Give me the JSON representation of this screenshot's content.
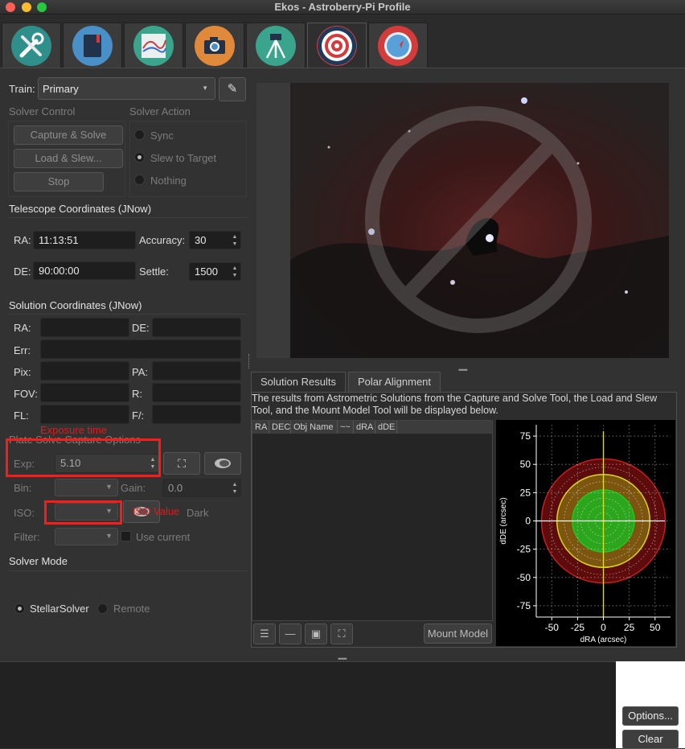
{
  "window": {
    "title": "Ekos - Astroberry-Pi Profile"
  },
  "module_tabs": [
    {
      "icon": "setup-wrench-icon",
      "color": "#2f8f8a"
    },
    {
      "icon": "scheduler-notebook-icon",
      "color": "#4a90c8"
    },
    {
      "icon": "analyze-graph-icon",
      "color": "#3aa58c"
    },
    {
      "icon": "capture-camera-icon",
      "color": "#e0893a"
    },
    {
      "icon": "mount-tripod-icon",
      "color": "#3aa58c"
    },
    {
      "icon": "align-target-icon",
      "color": "#d43c3c"
    },
    {
      "icon": "guide-compass-icon",
      "color": "#d43c3c"
    }
  ],
  "train": {
    "label": "Train:",
    "value": "Primary"
  },
  "solver_control": {
    "title": "Solver Control",
    "capture_solve": "Capture & Solve",
    "load_slew": "Load & Slew...",
    "stop": "Stop"
  },
  "solver_action": {
    "title": "Solver Action",
    "options": [
      "Sync",
      "Slew to Target",
      "Nothing"
    ],
    "selected": 1
  },
  "telescope_coords": {
    "title": "Telescope Coordinates (JNow)",
    "ra_label": "RA:",
    "ra": "11:13:51",
    "de_label": "DE:",
    "de": "90:00:00",
    "accuracy_label": "Accuracy:",
    "accuracy": "30",
    "settle_label": "Settle:",
    "settle": "1500"
  },
  "solution_coords": {
    "title": "Solution Coordinates (JNow)",
    "ra_label": "RA:",
    "de_label": "DE:",
    "err_label": "Err:",
    "pix_label": "Pix:",
    "pa_label": "PA:",
    "fov_label": "FOV:",
    "r_label": "R:",
    "fl_label": "FL:",
    "f_label": "F/:"
  },
  "capture_options": {
    "title": "Plate Solve Capture Options",
    "exp_label": "Exp:",
    "exp": "5.10",
    "bin_label": "Bin:",
    "gain_label": "Gain:",
    "gain": "0.0",
    "iso_label": "ISO:",
    "dark_label": "Dark",
    "filter_label": "Filter:",
    "use_current": "Use current"
  },
  "annotations": {
    "exposure": "Exposure time",
    "iso": "ISO Value"
  },
  "solver_mode": {
    "title": "Solver Mode",
    "options": [
      "StellarSolver",
      "Remote"
    ],
    "selected": 0
  },
  "results_tabs": [
    "Solution Results",
    "Polar Alignment"
  ],
  "results_description": "The results from Astrometric Solutions from the Capture and Solve Tool, the Load and Slew Tool, and the Mount Model Tool will be displayed below.",
  "table_columns": [
    "RA",
    "DEC",
    "Obj Name",
    "~~",
    "dRA",
    "dDE"
  ],
  "mount_model_button": "Mount Model",
  "bottom_buttons": {
    "options": "Options...",
    "clear": "Clear"
  },
  "chart_data": {
    "type": "scatter",
    "xlabel": "dRA (arcsec)",
    "ylabel": "dDE (arcsec)",
    "xlim": [
      -65,
      65
    ],
    "ylim": [
      -85,
      85
    ],
    "x_ticks": [
      -50,
      -25,
      0,
      25,
      50
    ],
    "y_ticks": [
      75,
      50,
      25,
      0,
      -25,
      -50,
      -75
    ],
    "accuracy_rings": [
      {
        "radius": 60,
        "color": "#c81e1e"
      },
      {
        "radius": 45,
        "color": "#d8d820"
      },
      {
        "radius": 30,
        "color": "#22c822"
      }
    ],
    "points": [],
    "background": "#000000"
  }
}
